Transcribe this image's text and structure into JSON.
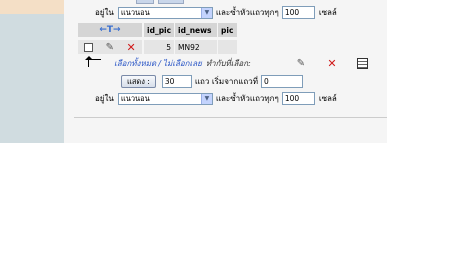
{
  "toolbar": {
    "show_in_label": "อยู่ใน",
    "mode_value": "แนวนอน",
    "repeat_header_label": "และซ้ำหัวแถวทุกๆ",
    "repeat_count": "100",
    "cells_label": "เซลล์"
  },
  "table": {
    "sort_glyph": "←T→",
    "columns": [
      "id_pic",
      "id_news",
      "pic"
    ],
    "rows": [
      {
        "id_pic": "5",
        "id_news": "MN92",
        "pic": ""
      }
    ]
  },
  "bulk_actions": {
    "select_all": "เลือกทั้งหมด",
    "separator": "/",
    "deselect_all": "ไม่เลือกเลย",
    "with_selected": "ทำกับที่เลือก:"
  },
  "pager": {
    "show_button": "แสดง :",
    "rows_value": "30",
    "rows_from_label": "แถว เริ่มจากแถวที่",
    "start_value": "0"
  },
  "colors": {
    "sidebar": "#d0dce0",
    "main_bg": "#f5f5f5",
    "link": "#2a56c6",
    "delete": "#d01818"
  }
}
